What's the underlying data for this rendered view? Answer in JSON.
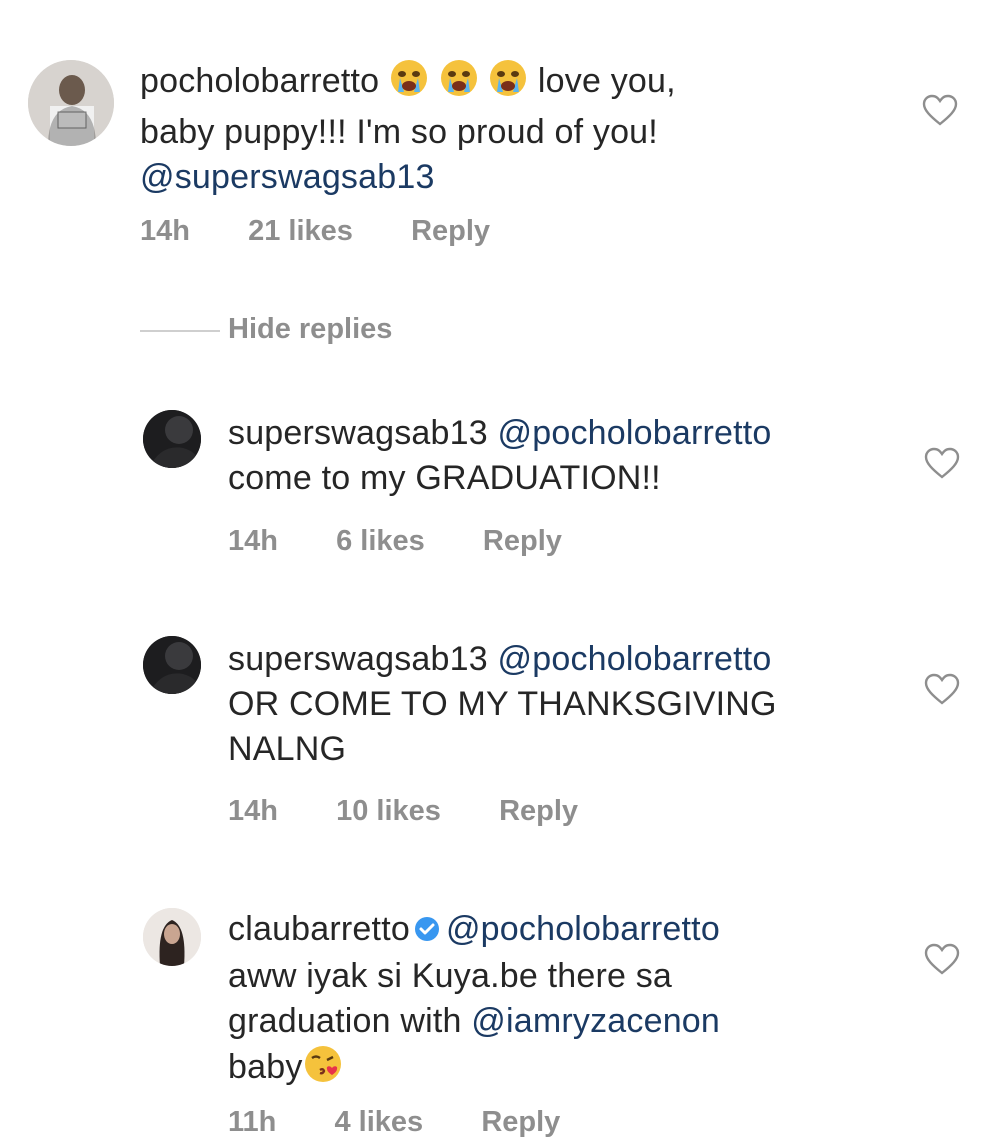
{
  "comments": [
    {
      "username": "pocholobarretto",
      "line1_after_emoji": "love you,",
      "line2": "baby puppy!!! I'm so proud of you!",
      "mention": "@superswagsab13",
      "time": "14h",
      "likes": "21 likes",
      "reply": "Reply",
      "emojis": [
        "crying-face-emoji",
        "crying-face-emoji",
        "crying-face-emoji"
      ]
    },
    {
      "username": "superswagsab13",
      "mention": "@pocholobarretto",
      "line2": "come to my GRADUATION!!",
      "time": "14h",
      "likes": "6 likes",
      "reply": "Reply"
    },
    {
      "username": "superswagsab13",
      "mention": "@pocholobarretto",
      "line2": "OR COME TO MY THANKSGIVING",
      "line3": "NALNG",
      "time": "14h",
      "likes": "10 likes",
      "reply": "Reply"
    },
    {
      "username": "claubarretto",
      "mention": "@pocholobarretto",
      "line2": "aww iyak si Kuya.be there sa",
      "line3_before": "graduation with ",
      "line3_mention": "@iamryzacenon",
      "line4": "baby",
      "time": "11h",
      "likes": "4 likes",
      "reply": "Reply",
      "verified": true,
      "emoji": "kissing-heart-emoji"
    }
  ],
  "hide_replies": "Hide replies",
  "colors": {
    "text": "#262626",
    "meta": "#8e8e8e",
    "mention": "#1b3a63",
    "verified": "#3897f0"
  }
}
